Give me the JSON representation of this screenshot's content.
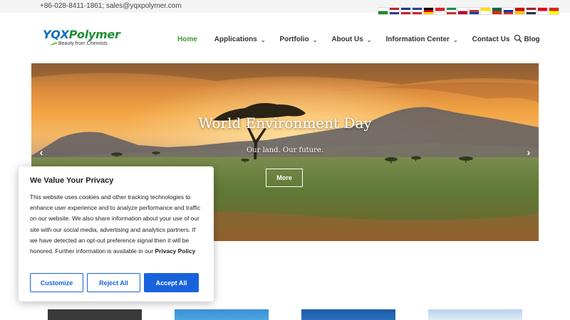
{
  "topbar": {
    "contact": "+86-028-8411-1861; sales@yqxpolymer.com",
    "flags": [
      {
        "name": "arabic-flag-icon",
        "colors": [
          "#ffffff",
          "#1d8a2a"
        ]
      },
      {
        "name": "dutch-flag-icon",
        "colors": [
          "#c2202e",
          "#ffffff",
          "#2a3f8c"
        ]
      },
      {
        "name": "uk-flag-icon",
        "colors": [
          "#1b3a82",
          "#ffffff",
          "#cc1f2f"
        ]
      },
      {
        "name": "french-flag-icon",
        "colors": [
          "#2a3f8c",
          "#ffffff",
          "#d2202e"
        ]
      },
      {
        "name": "german-flag-icon",
        "colors": [
          "#000000",
          "#dd0000",
          "#ffce00"
        ]
      },
      {
        "name": "indonesian-flag-icon",
        "colors": [
          "#e01b24",
          "#ffffff"
        ]
      },
      {
        "name": "italian-flag-icon",
        "colors": [
          "#119146",
          "#ffffff",
          "#ce2b37"
        ]
      },
      {
        "name": "japanese-flag-icon",
        "colors": [
          "#ffffff",
          "#bc002d"
        ]
      },
      {
        "name": "korean-flag-icon",
        "colors": [
          "#ffffff",
          "#cd2e3a",
          "#0047a0"
        ]
      },
      {
        "name": "flag-icon",
        "colors": [
          "#ffe000",
          "#ffffff"
        ]
      },
      {
        "name": "portuguese-flag-icon",
        "colors": [
          "#046a38",
          "#da291c"
        ]
      },
      {
        "name": "russian-flag-icon",
        "colors": [
          "#ffffff",
          "#0039a6",
          "#d52b1e"
        ]
      },
      {
        "name": "spanish-flag-icon",
        "colors": [
          "#c60b1e",
          "#ffc400"
        ]
      },
      {
        "name": "thai-flag-icon",
        "colors": [
          "#a51931",
          "#ffffff",
          "#2d2a4a"
        ]
      },
      {
        "name": "turkish-flag-icon",
        "colors": [
          "#e30a17",
          "#ffffff"
        ]
      },
      {
        "name": "vietnamese-flag-icon",
        "colors": [
          "#da251d",
          "#ffff00"
        ]
      }
    ]
  },
  "logo": {
    "main_q": "YQX",
    "main_rest": "Polymer",
    "tagline": "Beauty from Chemists"
  },
  "nav": {
    "items": [
      {
        "label": "Home",
        "active": true,
        "dropdown": false
      },
      {
        "label": "Applications",
        "active": false,
        "dropdown": true
      },
      {
        "label": "Portfolio",
        "active": false,
        "dropdown": true
      },
      {
        "label": "About Us",
        "active": false,
        "dropdown": true
      },
      {
        "label": "Information Center",
        "active": false,
        "dropdown": true
      },
      {
        "label": "Contact Us",
        "active": false,
        "dropdown": false
      },
      {
        "label": "Blog",
        "active": false,
        "dropdown": false
      }
    ],
    "search_icon": "search-icon"
  },
  "hero": {
    "title": "World Environment Day",
    "subtitle": "Our land. Our future.",
    "button": "More",
    "prev_arrow": "‹",
    "next_arrow": "›"
  },
  "privacy": {
    "title": "We Value Your Privacy",
    "body": "This website uses cookies and other tracking technologies to enhance user experience and to analyze performance and traffic on our website. We also share information about your use of our site with our social media, advertising and analytics partners. If we have detected an opt-out preference signal then it will be honored. Further information is available in our ",
    "policy_link": "Privacy Policy",
    "customize": "Customize",
    "reject": "Reject All",
    "accept": "Accept All"
  },
  "colors": {
    "accent_green": "#3a9a2b",
    "consent_blue": "#1863dc"
  }
}
